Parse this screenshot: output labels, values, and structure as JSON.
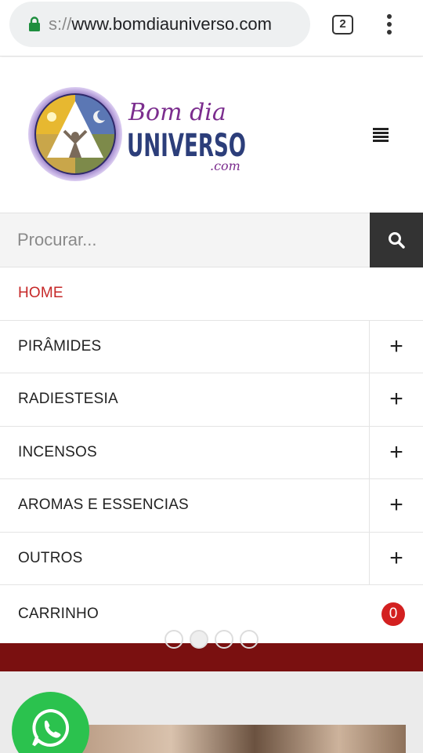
{
  "browser": {
    "url_scheme": "s://",
    "url_host": "www.bomdiauniverso.com",
    "tab_count": "2"
  },
  "logo": {
    "line1": "Bom dia",
    "line2": "UNIVERSO",
    "line3": ".com"
  },
  "search": {
    "placeholder": "Procurar..."
  },
  "menu": {
    "items": [
      {
        "label": "HOME",
        "active": true
      },
      {
        "label": "PIRÂMIDES",
        "expand": "+"
      },
      {
        "label": "RADIESTESIA",
        "expand": "+"
      },
      {
        "label": "INCENSOS",
        "expand": "+"
      },
      {
        "label": "AROMAS E ESSENCIAS",
        "expand": "+"
      },
      {
        "label": "OUTROS",
        "expand": "+"
      }
    ],
    "cart": {
      "label": "CARRINHO",
      "count": "0"
    }
  },
  "colors": {
    "accent_red": "#c62828",
    "badge_red": "#d32020",
    "search_button": "#333333",
    "banner": "#7a1010",
    "whatsapp_green": "#2bc24e",
    "logo_purple": "#7b2d8e",
    "logo_navy": "#2c3e7a"
  },
  "icons": [
    "lock-icon",
    "tab-switcher-icon",
    "overflow-menu-icon",
    "hamburger-menu-icon",
    "search-icon",
    "plus-icon",
    "whatsapp-icon"
  ]
}
